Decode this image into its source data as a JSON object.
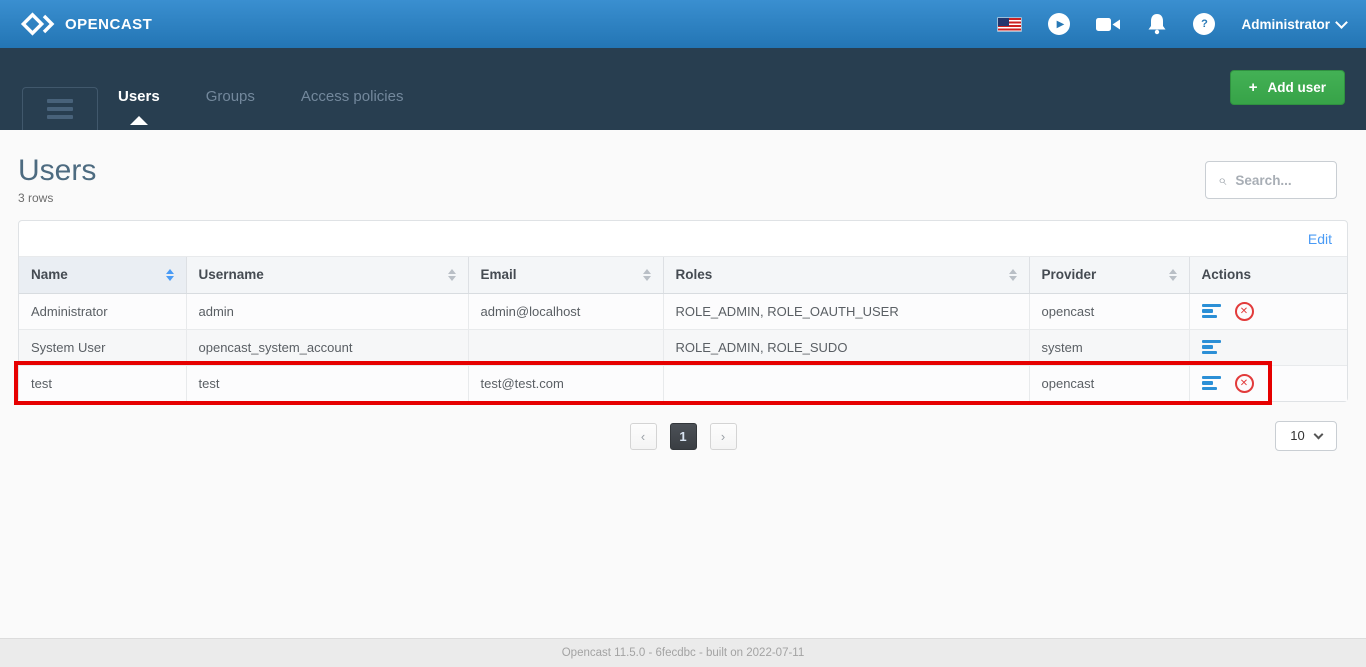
{
  "header": {
    "brand": "OPENCAST",
    "language_flag": "us-flag",
    "icons": [
      "play-icon",
      "camera-icon",
      "bell-icon",
      "help-icon"
    ],
    "help_glyph": "?",
    "play_glyph": "▶",
    "user_menu_label": "Administrator"
  },
  "nav": {
    "tabs": [
      {
        "label": "Users",
        "active": true
      },
      {
        "label": "Groups",
        "active": false
      },
      {
        "label": "Access policies",
        "active": false
      }
    ],
    "add_user_label": "Add user",
    "add_user_plus": "+"
  },
  "page": {
    "title": "Users",
    "row_count": "3 rows",
    "search_placeholder": "Search...",
    "search_glyph": "⌕",
    "edit_link": "Edit"
  },
  "table": {
    "columns": [
      {
        "label": "Name",
        "sortable": true,
        "sorted": true
      },
      {
        "label": "Username",
        "sortable": true,
        "sorted": false
      },
      {
        "label": "Email",
        "sortable": true,
        "sorted": false
      },
      {
        "label": "Roles",
        "sortable": true,
        "sorted": false
      },
      {
        "label": "Provider",
        "sortable": true,
        "sorted": false
      },
      {
        "label": "Actions",
        "sortable": false,
        "sorted": false
      }
    ],
    "rows": [
      {
        "name": "Administrator",
        "username": "admin",
        "email": "admin@localhost",
        "roles": "ROLE_ADMIN, ROLE_OAUTH_USER",
        "provider": "opencast",
        "deletable": true,
        "highlighted": false
      },
      {
        "name": "System User",
        "username": "opencast_system_account",
        "email": "",
        "roles": "ROLE_ADMIN, ROLE_SUDO",
        "provider": "system",
        "deletable": false,
        "highlighted": false
      },
      {
        "name": "test",
        "username": "test",
        "email": "test@test.com",
        "roles": "",
        "provider": "opencast",
        "deletable": true,
        "highlighted": true
      }
    ],
    "delete_glyph": "✕"
  },
  "pagination": {
    "prev_glyph": "‹",
    "next_glyph": "›",
    "active_page": "1",
    "per_page_value": "10"
  },
  "footer": {
    "text": "Opencast 11.5.0 - 6fecdbc - built on 2022-07-11"
  },
  "colors": {
    "topbar_blue": "#2f82c2",
    "nav_dark": "#283e50",
    "accent_blue": "#2b8fd6",
    "link_blue": "#4a9bf5",
    "button_green": "#3aa84b",
    "delete_red": "#e23b3b",
    "annotation_red": "#e60000"
  }
}
